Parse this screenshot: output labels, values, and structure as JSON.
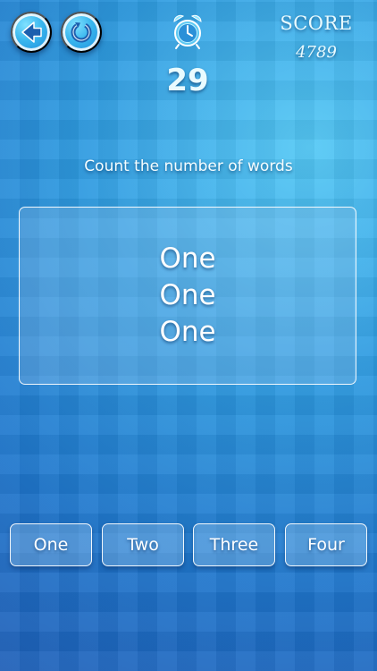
{
  "header": {
    "back_icon": "arrow-left-icon",
    "restart_icon": "restart-icon",
    "timer_icon": "alarm-clock-icon",
    "timer_value": "29",
    "score_label": "SCORE",
    "score_value": "4789"
  },
  "instruction": "Count the number of words",
  "panel": {
    "words": [
      "One",
      "One",
      "One"
    ]
  },
  "answers": [
    "One",
    "Two",
    "Three",
    "Four"
  ],
  "colors": {
    "accent": "#38b6ee",
    "background_light": "#55c9f6",
    "background_dark": "#1e5fb8"
  }
}
